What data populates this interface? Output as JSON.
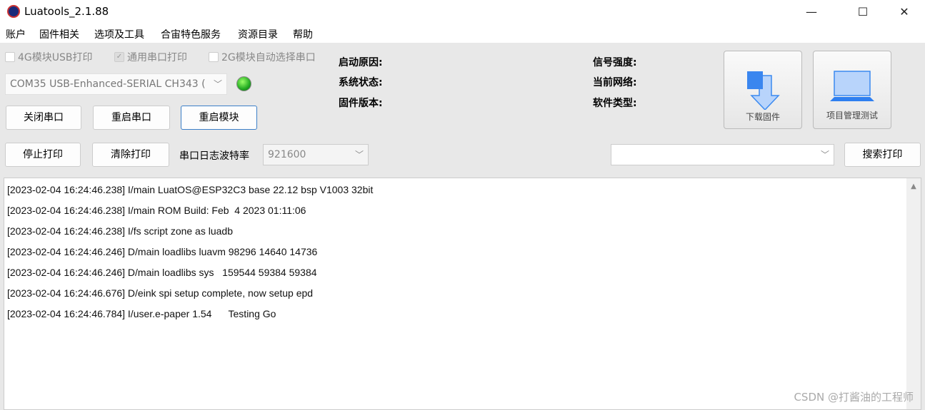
{
  "window": {
    "title": "Luatools_2.1.88",
    "minimize": "—",
    "maximize": "☐",
    "close": "✕"
  },
  "menu": [
    "账户",
    "固件相关",
    "选项及工具",
    "合宙特色服务",
    "资源目录",
    "帮助"
  ],
  "checkboxes": [
    {
      "label": "4G模块USB打印",
      "checked": false
    },
    {
      "label": "通用串口打印",
      "checked": true
    },
    {
      "label": "2G模块自动选择串口",
      "checked": false
    }
  ],
  "port": {
    "value": "COM35 USB-Enhanced-SERIAL CH343 (",
    "status_color": "#2ecc1a"
  },
  "buttons": {
    "close_port": "关闭串口",
    "restart_port": "重启串口",
    "restart_module": "重启模块",
    "stop_print": "停止打印",
    "clear_print": "清除打印",
    "search_print": "搜索打印"
  },
  "baud": {
    "label": "串口日志波特率",
    "value": "921600"
  },
  "info": {
    "boot_reason": "启动原因:",
    "system_status": "系统状态:",
    "firmware_version": "固件版本:",
    "signal": "信号强度:",
    "network": "当前网络:",
    "software_type": "软件类型:"
  },
  "tools": {
    "download": "下载固件",
    "project": "项目管理测试"
  },
  "search": {
    "value": ""
  },
  "log": [
    "[2023-02-04 16:24:46.238] I/main LuatOS@ESP32C3 base 22.12 bsp V1003 32bit",
    "[2023-02-04 16:24:46.238] I/main ROM Build: Feb  4 2023 01:11:06",
    "[2023-02-04 16:24:46.238] I/fs script zone as luadb",
    "[2023-02-04 16:24:46.246] D/main loadlibs luavm 98296 14640 14736",
    "[2023-02-04 16:24:46.246] D/main loadlibs sys   159544 59384 59384",
    "[2023-02-04 16:24:46.676] D/eink spi setup complete, now setup epd",
    "[2023-02-04 16:24:46.784] I/user.e-paper 1.54      Testing Go"
  ],
  "watermark": "CSDN @打酱油的工程师"
}
